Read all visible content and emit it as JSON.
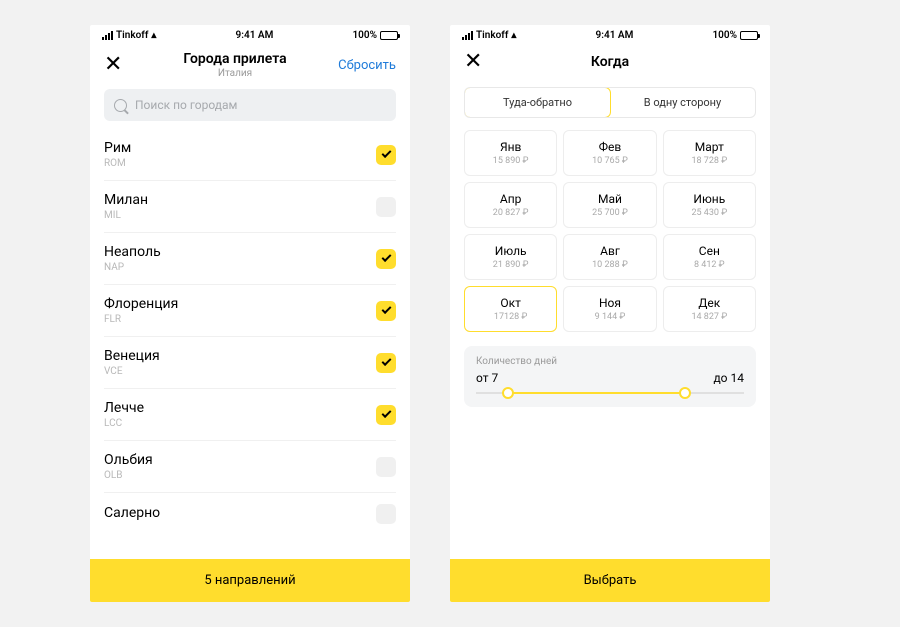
{
  "status": {
    "carrier": "Tinkoff",
    "time": "9:41 AM",
    "battery": "100%"
  },
  "screen1": {
    "title": "Города прилета",
    "subtitle": "Италия",
    "reset": "Сбросить",
    "search_placeholder": "Поиск по городам",
    "cities": [
      {
        "name": "Рим",
        "code": "ROM",
        "checked": true
      },
      {
        "name": "Милан",
        "code": "MIL",
        "checked": false
      },
      {
        "name": "Неаполь",
        "code": "NAP",
        "checked": true
      },
      {
        "name": "Флоренция",
        "code": "FLR",
        "checked": true
      },
      {
        "name": "Венеция",
        "code": "VCE",
        "checked": true
      },
      {
        "name": "Лечче",
        "code": "LCC",
        "checked": true
      },
      {
        "name": "Ольбия",
        "code": "OLB",
        "checked": false
      },
      {
        "name": "Салерно",
        "code": "",
        "checked": false
      }
    ],
    "footer": "5 направлений"
  },
  "screen2": {
    "title": "Когда",
    "tabs": {
      "round": "Туда-обратно",
      "oneway": "В одну сторону"
    },
    "months": [
      {
        "name": "Янв",
        "price": "15 890 ₽",
        "selected": false
      },
      {
        "name": "Фев",
        "price": "10 765 ₽",
        "selected": false
      },
      {
        "name": "Март",
        "price": "18 728 ₽",
        "selected": false
      },
      {
        "name": "Апр",
        "price": "20 827 ₽",
        "selected": false
      },
      {
        "name": "Май",
        "price": "25 700 ₽",
        "selected": false
      },
      {
        "name": "Июнь",
        "price": "25 430 ₽",
        "selected": false
      },
      {
        "name": "Июль",
        "price": "21 890 ₽",
        "selected": false
      },
      {
        "name": "Авг",
        "price": "10 288 ₽",
        "selected": false
      },
      {
        "name": "Сен",
        "price": "8 412 ₽",
        "selected": false
      },
      {
        "name": "Окт",
        "price": "17128 ₽",
        "selected": true
      },
      {
        "name": "Ноя",
        "price": "9 144 ₽",
        "selected": false
      },
      {
        "name": "Дек",
        "price": "14 827 ₽",
        "selected": false
      }
    ],
    "days": {
      "label": "Количество дней",
      "from": "от 7",
      "to": "до 14"
    },
    "footer": "Выбрать"
  }
}
